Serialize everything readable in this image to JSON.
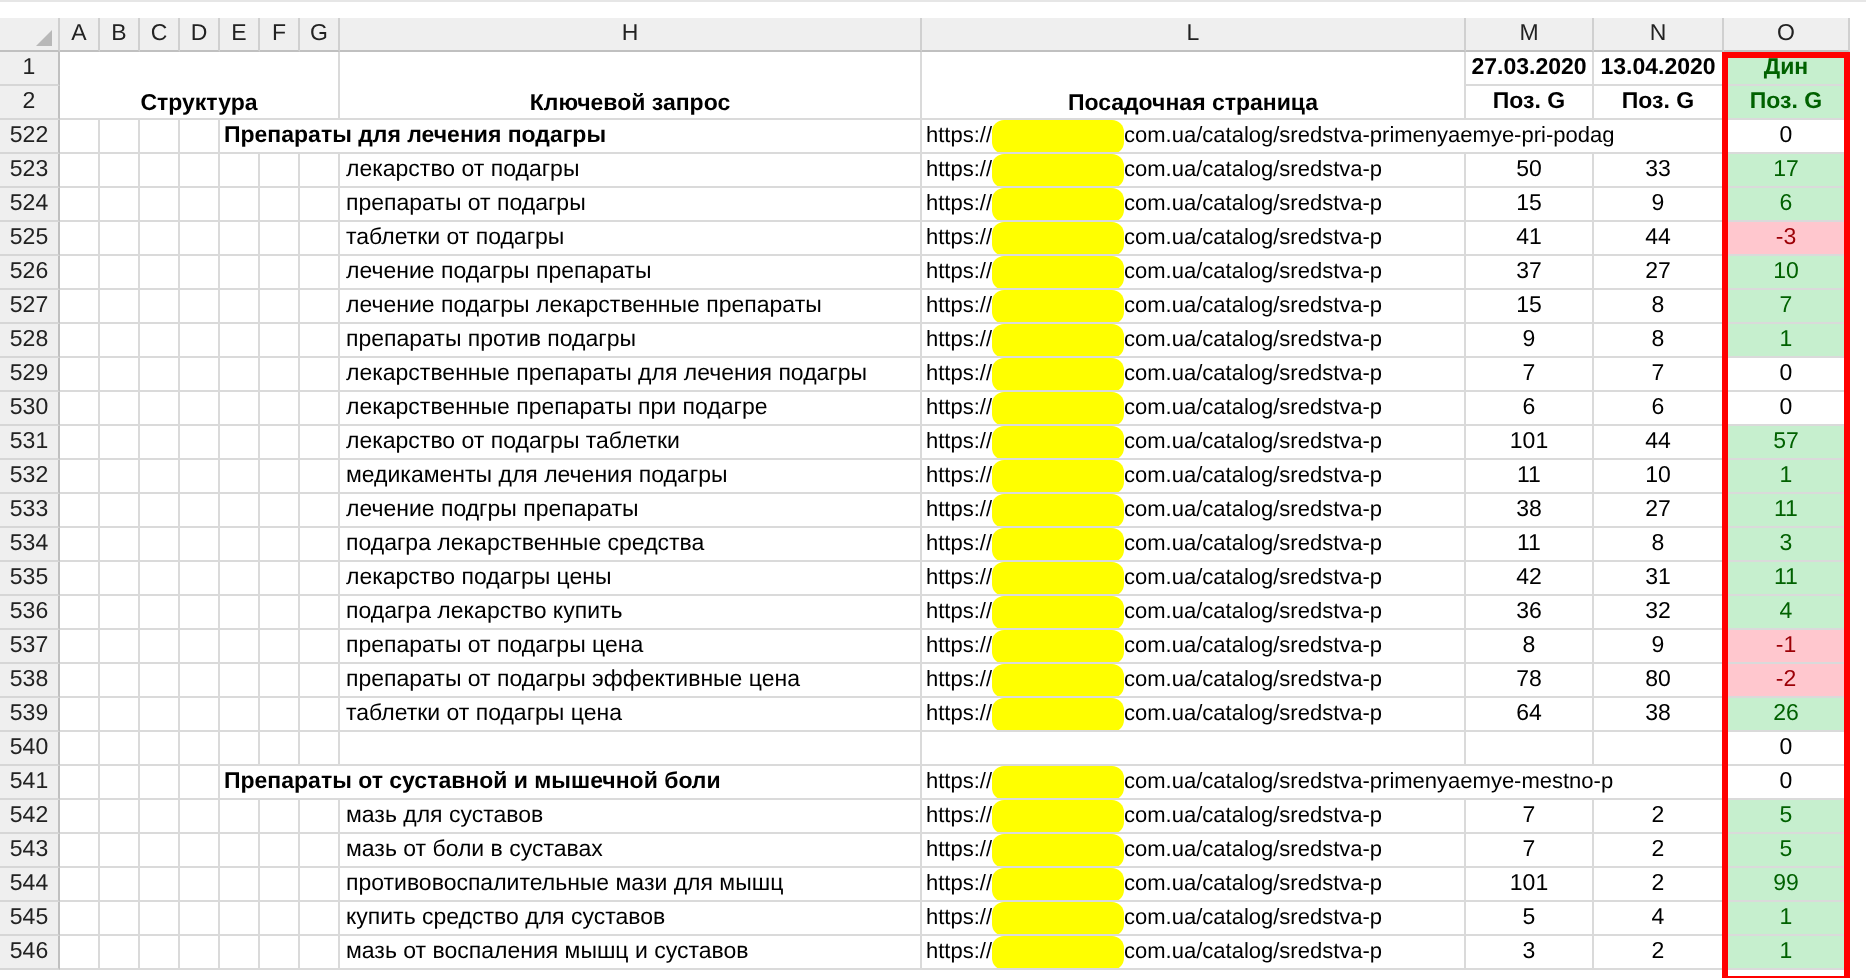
{
  "column_headers": [
    "A",
    "B",
    "C",
    "D",
    "E",
    "F",
    "G",
    "H",
    "L",
    "M",
    "N",
    "O"
  ],
  "header_rows": [
    {
      "number": "1",
      "m": "27.03.2020",
      "n": "13.04.2020",
      "o": "Дин"
    },
    {
      "number": "2",
      "structure": "Структура",
      "keyword": "Ключевой запрос",
      "landing": "Посадочная страница",
      "m": "Поз. G",
      "n": "Поз. G",
      "o": "Поз. G"
    }
  ],
  "rows": [
    {
      "number": "522",
      "kind": "group",
      "keyword": "Препараты для лечения подагры",
      "url_start": "https://",
      "url_end": "com.ua/catalog/sredstva-primenyaemye-pri-podag",
      "o": "0",
      "up": false,
      "down": false
    },
    {
      "number": "523",
      "kind": "query",
      "keyword": "лекарство от подагры",
      "url_start": "https://",
      "url_end": "com.ua/catalog/sredstva-p",
      "m": "50",
      "n": "33",
      "o": "17",
      "up": true,
      "down": false
    },
    {
      "number": "524",
      "kind": "query",
      "keyword": "препараты от подагры",
      "url_start": "https://",
      "url_end": "com.ua/catalog/sredstva-p",
      "m": "15",
      "n": "9",
      "o": "6",
      "up": true,
      "down": false
    },
    {
      "number": "525",
      "kind": "query",
      "keyword": "таблетки от подагры",
      "url_start": "https://",
      "url_end": "com.ua/catalog/sredstva-p",
      "m": "41",
      "n": "44",
      "o": "-3",
      "up": false,
      "down": true
    },
    {
      "number": "526",
      "kind": "query",
      "keyword": "лечение подагры препараты",
      "url_start": "https://",
      "url_end": "com.ua/catalog/sredstva-p",
      "m": "37",
      "n": "27",
      "o": "10",
      "up": true,
      "down": false
    },
    {
      "number": "527",
      "kind": "query",
      "keyword": "лечение подагры лекарственные препараты",
      "url_start": "https://",
      "url_end": "com.ua/catalog/sredstva-p",
      "m": "15",
      "n": "8",
      "o": "7",
      "up": true,
      "down": false
    },
    {
      "number": "528",
      "kind": "query",
      "keyword": "препараты против подагры",
      "url_start": "https://",
      "url_end": "com.ua/catalog/sredstva-p",
      "m": "9",
      "n": "8",
      "o": "1",
      "up": true,
      "down": false
    },
    {
      "number": "529",
      "kind": "query",
      "keyword": "лекарственные препараты для лечения подагры",
      "url_start": "https://",
      "url_end": "com.ua/catalog/sredstva-p",
      "m": "7",
      "n": "7",
      "o": "0",
      "up": false,
      "down": false
    },
    {
      "number": "530",
      "kind": "query",
      "keyword": "лекарственные препараты при подагре",
      "url_start": "https://",
      "url_end": "com.ua/catalog/sredstva-p",
      "m": "6",
      "n": "6",
      "o": "0",
      "up": false,
      "down": false
    },
    {
      "number": "531",
      "kind": "query",
      "keyword": "лекарство от подагры таблетки",
      "url_start": "https://",
      "url_end": "com.ua/catalog/sredstva-p",
      "m": "101",
      "n": "44",
      "o": "57",
      "up": true,
      "down": false
    },
    {
      "number": "532",
      "kind": "query",
      "keyword": "медикаменты для лечения подагры",
      "url_start": "https://",
      "url_end": "com.ua/catalog/sredstva-p",
      "m": "11",
      "n": "10",
      "o": "1",
      "up": true,
      "down": false
    },
    {
      "number": "533",
      "kind": "query",
      "keyword": "лечение подгры препараты",
      "url_start": "https://",
      "url_end": "com.ua/catalog/sredstva-p",
      "m": "38",
      "n": "27",
      "o": "11",
      "up": true,
      "down": false
    },
    {
      "number": "534",
      "kind": "query",
      "keyword": "подагра лекарственные средства",
      "url_start": "https://",
      "url_end": "com.ua/catalog/sredstva-p",
      "m": "11",
      "n": "8",
      "o": "3",
      "up": true,
      "down": false
    },
    {
      "number": "535",
      "kind": "query",
      "keyword": "лекарство подагры цены",
      "url_start": "https://",
      "url_end": "com.ua/catalog/sredstva-p",
      "m": "42",
      "n": "31",
      "o": "11",
      "up": true,
      "down": false
    },
    {
      "number": "536",
      "kind": "query",
      "keyword": "подагра лекарство купить",
      "url_start": "https://",
      "url_end": "com.ua/catalog/sredstva-p",
      "m": "36",
      "n": "32",
      "o": "4",
      "up": true,
      "down": false
    },
    {
      "number": "537",
      "kind": "query",
      "keyword": "препараты от подагры цена",
      "url_start": "https://",
      "url_end": "com.ua/catalog/sredstva-p",
      "m": "8",
      "n": "9",
      "o": "-1",
      "up": false,
      "down": true
    },
    {
      "number": "538",
      "kind": "query",
      "keyword": "препараты от подагры эффективные цена",
      "url_start": "https://",
      "url_end": "com.ua/catalog/sredstva-p",
      "m": "78",
      "n": "80",
      "o": "-2",
      "up": false,
      "down": true
    },
    {
      "number": "539",
      "kind": "query",
      "keyword": "таблетки от подагры цена",
      "url_start": "https://",
      "url_end": "com.ua/catalog/sredstva-p",
      "m": "64",
      "n": "38",
      "o": "26",
      "up": true,
      "down": false
    },
    {
      "number": "540",
      "kind": "empty",
      "o": "0",
      "up": false,
      "down": false
    },
    {
      "number": "541",
      "kind": "group",
      "keyword": "Препараты от суставной и мышечной боли",
      "url_start": "https://",
      "url_end": "com.ua/catalog/sredstva-primenyaemye-mestno-p",
      "o": "0",
      "up": false,
      "down": false
    },
    {
      "number": "542",
      "kind": "query",
      "keyword": "мазь для суставов",
      "url_start": "https://",
      "url_end": "com.ua/catalog/sredstva-p",
      "m": "7",
      "n": "2",
      "o": "5",
      "up": true,
      "down": false
    },
    {
      "number": "543",
      "kind": "query",
      "keyword": "мазь от боли в суставах",
      "url_start": "https://",
      "url_end": "com.ua/catalog/sredstva-p",
      "m": "7",
      "n": "2",
      "o": "5",
      "up": true,
      "down": false
    },
    {
      "number": "544",
      "kind": "query",
      "keyword": "противовоспалительные мази для мышц",
      "url_start": "https://",
      "url_end": "com.ua/catalog/sredstva-p",
      "m": "101",
      "n": "2",
      "o": "99",
      "up": true,
      "down": false
    },
    {
      "number": "545",
      "kind": "query",
      "keyword": "купить средство для суставов",
      "url_start": "https://",
      "url_end": "com.ua/catalog/sredstva-p",
      "m": "5",
      "n": "4",
      "o": "1",
      "up": true,
      "down": false
    },
    {
      "number": "546",
      "kind": "query",
      "keyword": "мазь от воспаления мышц и суставов",
      "url_start": "https://",
      "url_end": "com.ua/catalog/sredstva-p",
      "m": "3",
      "n": "2",
      "o": "1",
      "up": true,
      "down": false
    }
  ]
}
